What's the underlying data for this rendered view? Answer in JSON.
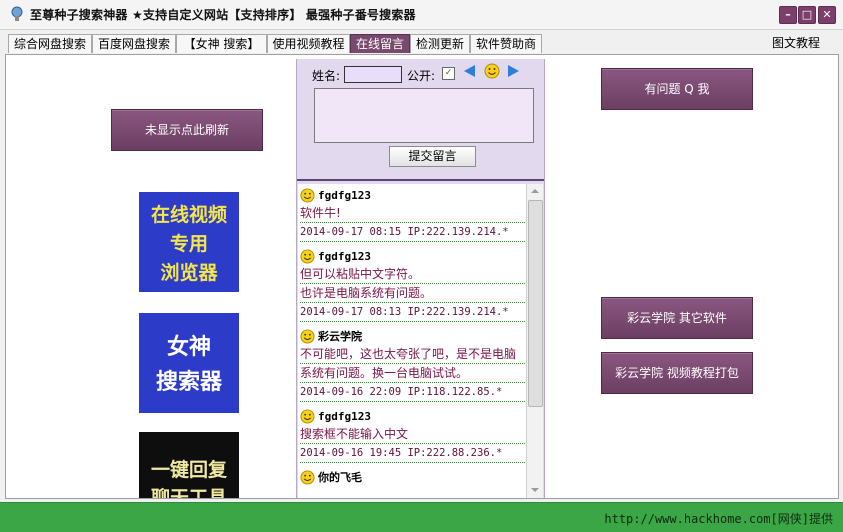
{
  "window": {
    "title": "至尊种子搜索神器  ★支持自定义网站【支持排序】 最强种子番号搜索器",
    "controls": {
      "minimize": "–",
      "maximize": "□",
      "close": "✕"
    }
  },
  "tabs": [
    {
      "label": "综合网盘搜索",
      "active": false
    },
    {
      "label": "百度网盘搜索",
      "active": false
    },
    {
      "label": "【女神 搜索】",
      "active": false
    },
    {
      "label": "使用视频教程",
      "active": false
    },
    {
      "label": "在线留言",
      "active": true
    },
    {
      "label": "检测更新",
      "active": false
    },
    {
      "label": "软件赞助商",
      "active": false
    }
  ],
  "tab_right_label": "图文教程",
  "left": {
    "refresh_button": "未显示点此刷新",
    "promos": [
      {
        "text_lines": [
          "在线视频",
          "专用",
          "浏览器"
        ],
        "bg": "#2d3bc9",
        "fg": "#f4e64a"
      },
      {
        "text_lines": [
          "女神",
          "搜索器"
        ],
        "bg": "#2d3bc9",
        "fg": "#ffffff"
      },
      {
        "text_lines": [
          "一键回复",
          "聊天工具"
        ],
        "bg": "#0e0e0e",
        "fg": "#f2e9a0"
      }
    ]
  },
  "guestbook": {
    "name_label": "姓名:",
    "name_value": "",
    "public_label": "公开:",
    "public_checked": true,
    "message_value": "",
    "submit_label": "提交留言",
    "entries": [
      {
        "name": "fgdfg123",
        "lines": [
          "软件牛!"
        ],
        "meta": "2014-09-17 08:15 IP:222.139.214.*"
      },
      {
        "name": "fgdfg123",
        "lines": [
          "但可以粘贴中文字符。",
          "也许是电脑系统有问题。"
        ],
        "meta": "2014-09-17 08:13 IP:222.139.214.*"
      },
      {
        "name": "彩云学院",
        "lines": [
          "不可能吧，这也太夸张了吧，是不是电脑",
          "系统有问题。换一台电脑试试。"
        ],
        "meta": "2014-09-16 22:09 IP:118.122.85.*"
      },
      {
        "name": "fgdfg123",
        "lines": [
          "搜索框不能输入中文"
        ],
        "meta": "2014-09-16 19:45 IP:222.88.236.*"
      },
      {
        "name": "你的飞毛",
        "lines": [],
        "meta": ""
      }
    ]
  },
  "right": {
    "qq_button": "有问题 Q 我",
    "other_soft_button": "彩云学院 其它软件",
    "video_pack_button": "彩云学院 视频教程打包"
  },
  "status_bar": {
    "text": "http://www.hackhome.com[网侠]提供"
  },
  "colors": {
    "accent": "#7a4a6e",
    "panel_bg": "#e3d9ee",
    "status_green": "#3aa646",
    "message_text": "#7a1448"
  }
}
